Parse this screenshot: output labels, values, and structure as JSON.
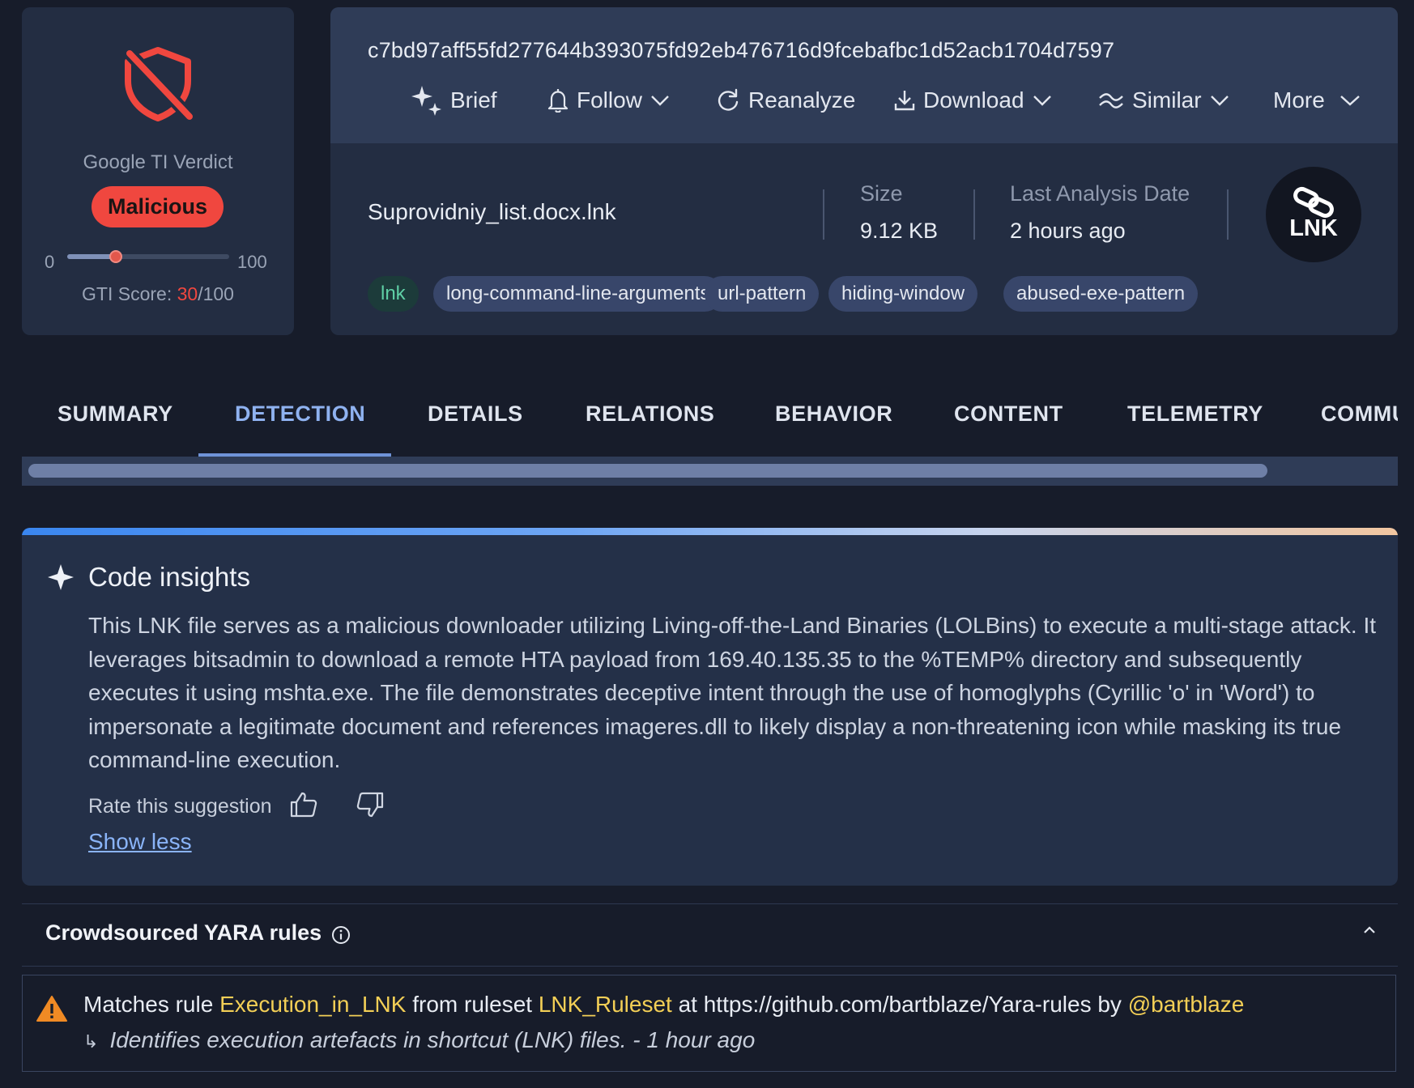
{
  "verdict": {
    "title": "Google TI Verdict",
    "badge": "Malicious",
    "slider_min": "0",
    "slider_max": "100",
    "score_label": "GTI Score: ",
    "score_value": "30",
    "score_max": "/100",
    "score_fraction": 0.3,
    "colors": {
      "malicious": "#f0473f"
    }
  },
  "file": {
    "hash": "c7bd97aff55fd277644b393075fd92eb476716d9fcebafbc1d52acb1704d7597",
    "name": "Suprovidniy_list.docx.lnk",
    "size_label": "Size",
    "size_value": "9.12 KB",
    "last_analysis_label": "Last Analysis Date",
    "last_analysis_value": "2 hours ago",
    "type_badge": "LNK",
    "type_icon": "chain-link-icon"
  },
  "toolbar": {
    "brief": "Brief",
    "follow": "Follow",
    "reanalyze": "Reanalyze",
    "download": "Download",
    "similar": "Similar",
    "more": "More"
  },
  "tags": [
    "lnk",
    "long-command-line-arguments",
    "url-pattern",
    "hiding-window",
    "abused-exe-pattern"
  ],
  "tabs": [
    "SUMMARY",
    "DETECTION",
    "DETAILS",
    "RELATIONS",
    "BEHAVIOR",
    "CONTENT",
    "TELEMETRY",
    "COMMU"
  ],
  "active_tab": "DETECTION",
  "insights": {
    "title": "Code insights",
    "body": "This LNK file serves as a malicious downloader utilizing Living-off-the-Land Binaries (LOLBins) to execute a multi-stage attack. It leverages bitsadmin to download a remote HTA payload from 169.40.135.35 to the %TEMP% directory and subsequently executes it using mshta.exe. The file demonstrates deceptive intent through the use of homoglyphs (Cyrillic 'o' in 'Word') to impersonate a legitimate document and references imageres.dll to likely display a non-threatening icon while masking its true command-line execution.",
    "rate_label": "Rate this suggestion",
    "show_less": "Show less"
  },
  "yara": {
    "title": "Crowdsourced YARA rules",
    "match_prefix": "Matches rule ",
    "rule": "Execution_in_LNK",
    "from_text": " from ruleset ",
    "ruleset": "LNK_Ruleset",
    "at_text": " at https://github.com/bartblaze/Yara-rules by ",
    "author": "@bartblaze",
    "arrow": "↳",
    "description": "Identifies execution artefacts in shortcut (LNK) files. - 1 hour ago",
    "colors": {
      "highlight": "#f3cf56",
      "warning": "#f08a24"
    }
  }
}
